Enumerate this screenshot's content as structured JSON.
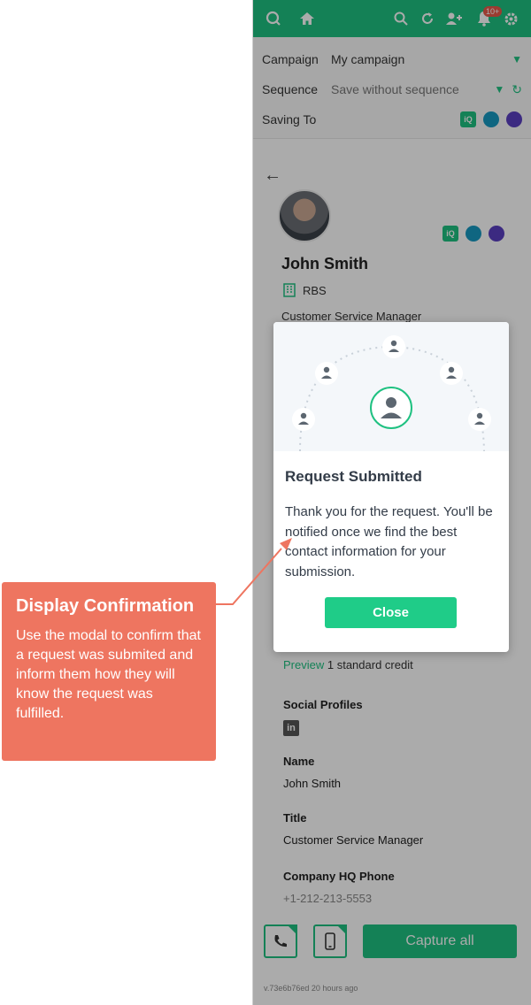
{
  "annotation": {
    "title": "Display Confirmation",
    "text": "Use the modal to confirm that a request was submited and inform them how they will know the request was fulfilled."
  },
  "topbar": {
    "icons": [
      "logo-icon",
      "home-icon",
      "search-icon",
      "refresh-icon",
      "add-user-icon",
      "bell-icon",
      "gear-icon"
    ],
    "notification_badge": "10+",
    "accent": "#1fc181"
  },
  "settings": {
    "campaign_label": "Campaign",
    "campaign_value": "My campaign",
    "sequence_label": "Sequence",
    "sequence_value": "Save without sequence",
    "saving_label": "Saving To"
  },
  "contact": {
    "name": "John Smith",
    "company": "RBS",
    "title": "Customer Service Manager",
    "preview_link": "Preview",
    "preview_text": " 1 standard credit"
  },
  "details": {
    "social_label": "Social Profiles",
    "linkedin": "in",
    "name_label": "Name",
    "name_value": "John Smith",
    "title_label": "Title",
    "title_value": "Customer Service Manager",
    "phone_label": "Company HQ Phone",
    "phone_value": "+1-212-213-5553"
  },
  "footer": {
    "capture_label": "Capture  all",
    "version": "v.73e6b76ed 20 hours ago"
  },
  "modal": {
    "title": "Request Submitted",
    "body": "Thank you for the request. You'll be notified once we find the best contact information for your submission.",
    "close_label": "Close",
    "button_color": "#1fcc88"
  }
}
